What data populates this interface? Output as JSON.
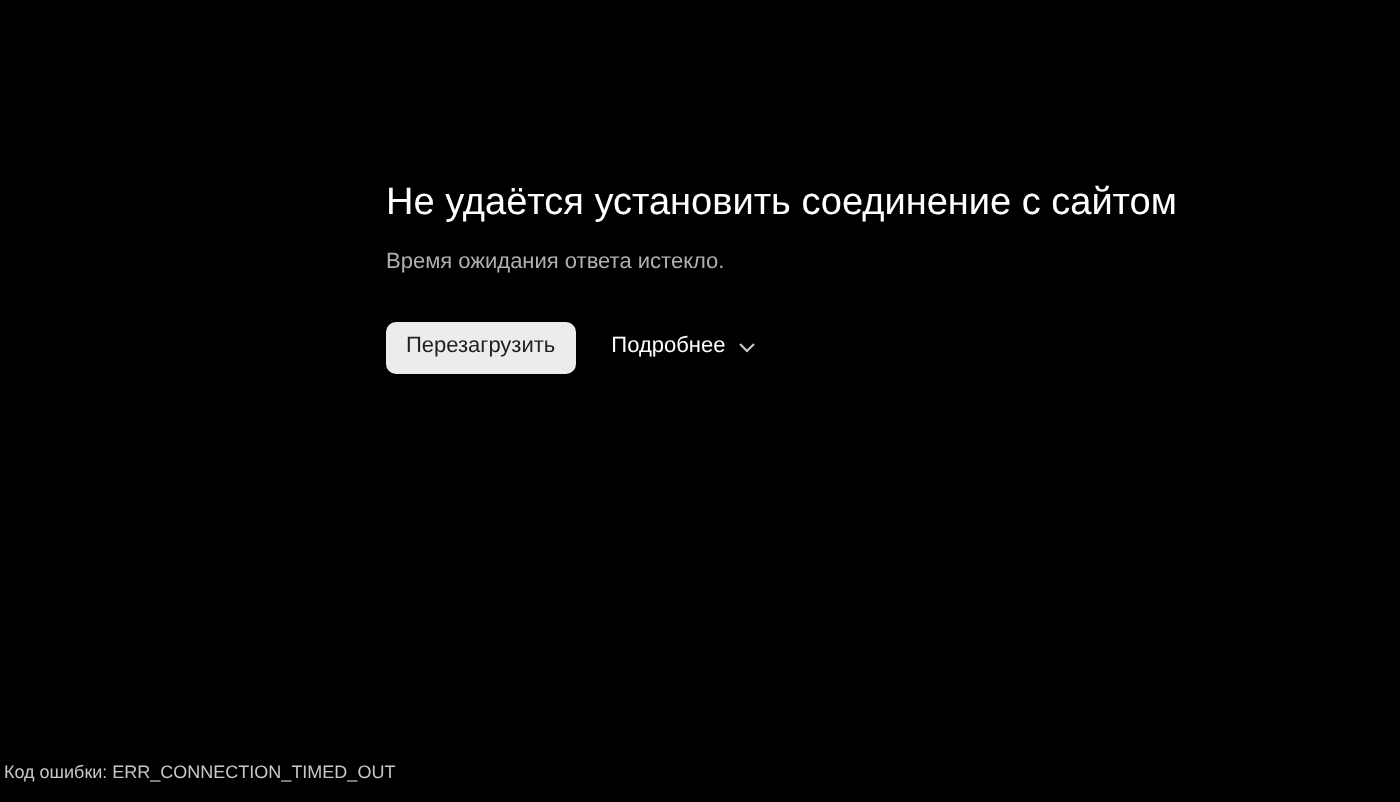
{
  "title": "Не удаётся установить соединение с сайтом",
  "message": "Время ожидания ответа истекло.",
  "reload_button": "Перезагрузить",
  "details_button": {
    "label": "Подробнее",
    "expanded": false
  },
  "error_code": "Код ошибки: ERR_CONNECTION_TIMED_OUT"
}
